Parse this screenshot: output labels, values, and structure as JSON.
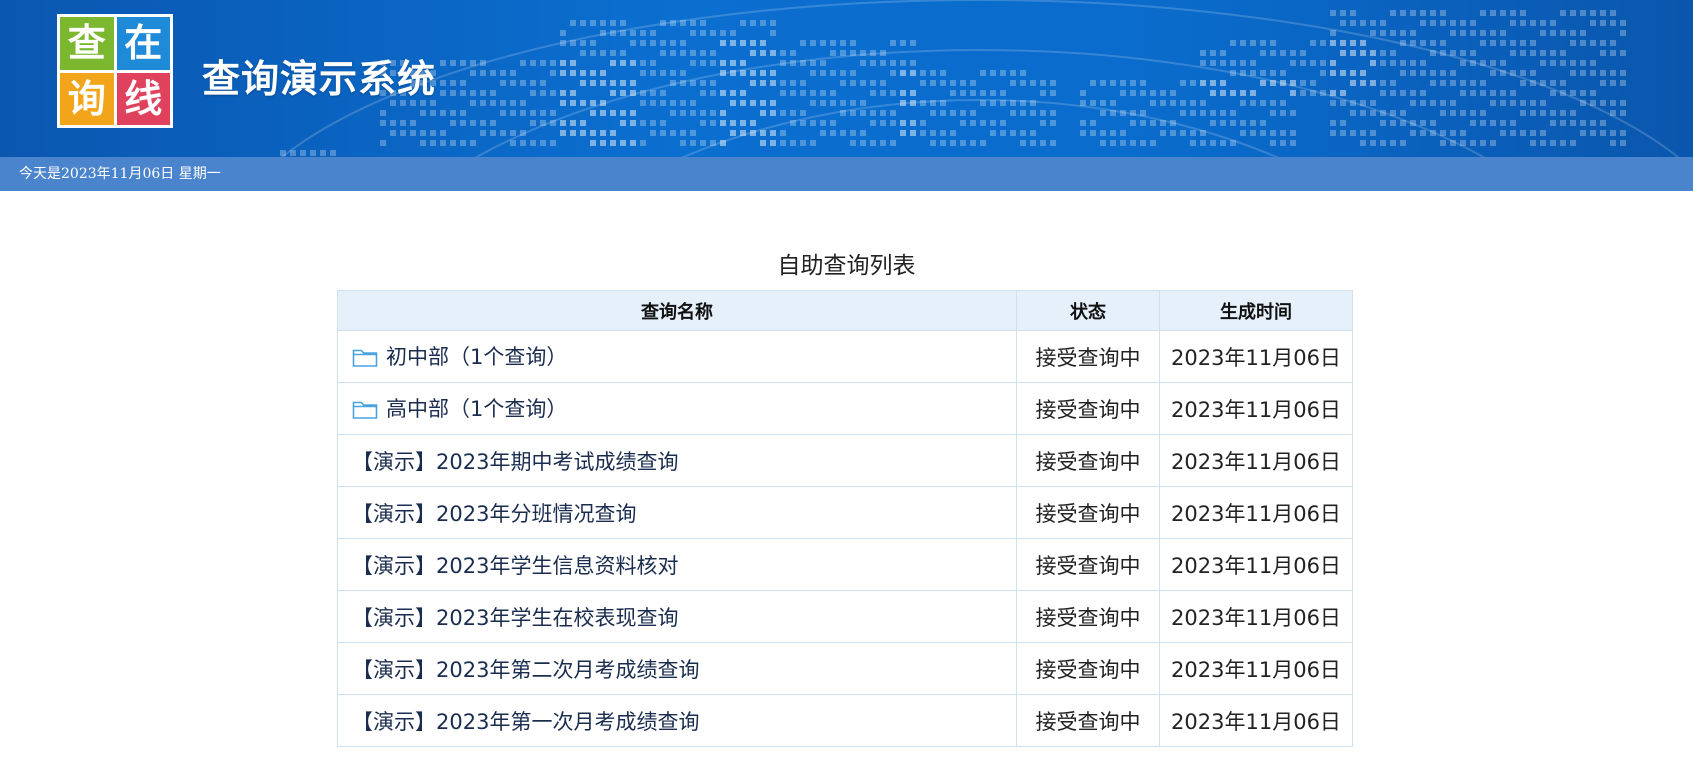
{
  "header": {
    "logo_chars": [
      "查",
      "在",
      "询",
      "线"
    ],
    "title": "查询演示系统",
    "date_text": "今天是2023年11月06日  星期一"
  },
  "main": {
    "list_title": "自助查询列表",
    "columns": [
      "查询名称",
      "状态",
      "生成时间"
    ],
    "rows": [
      {
        "name": "初中部（1个查询）",
        "folder": true,
        "status": "接受查询中",
        "time": "2023年11月06日"
      },
      {
        "name": "高中部（1个查询）",
        "folder": true,
        "status": "接受查询中",
        "time": "2023年11月06日"
      },
      {
        "name": "【演示】2023年期中考试成绩查询",
        "folder": false,
        "status": "接受查询中",
        "time": "2023年11月06日"
      },
      {
        "name": "【演示】2023年分班情况查询",
        "folder": false,
        "status": "接受查询中",
        "time": "2023年11月06日"
      },
      {
        "name": "【演示】2023年学生信息资料核对",
        "folder": false,
        "status": "接受查询中",
        "time": "2023年11月06日"
      },
      {
        "name": "【演示】2023年学生在校表现查询",
        "folder": false,
        "status": "接受查询中",
        "time": "2023年11月06日"
      },
      {
        "name": "【演示】2023年第二次月考成绩查询",
        "folder": false,
        "status": "接受查询中",
        "time": "2023年11月06日"
      },
      {
        "name": "【演示】2023年第一次月考成绩查询",
        "folder": false,
        "status": "接受查询中",
        "time": "2023年11月06日"
      }
    ]
  },
  "colors": {
    "banner": "#0b6fd0",
    "datebar": "#4a84cc",
    "table_header_bg": "#e5f0fb",
    "folder_icon": "#4aa3df"
  }
}
